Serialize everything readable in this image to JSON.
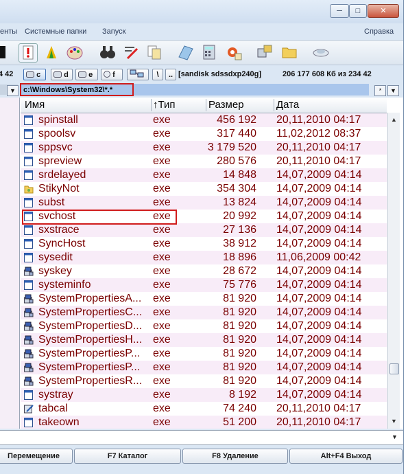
{
  "window": {
    "minimize_label": "─",
    "maximize_label": "□",
    "close_label": "✕"
  },
  "menu": [
    {
      "label": "енты"
    },
    {
      "label": "Системные папки"
    },
    {
      "label": "Запуск"
    },
    {
      "label": "Справка"
    }
  ],
  "toolbar_icons": [
    "black-square-icon",
    "exclamation-icon",
    "up-arrow-icon",
    "palette-icon",
    "binoculars-icon",
    "edit-pen-icon",
    "copy-document-icon",
    "notepad-icon",
    "calculator-icon",
    "settings-gear-icon",
    "network-icon",
    "folder-icon",
    "satellite-icon"
  ],
  "drives": {
    "left_fragment": "4 42",
    "items": [
      "c",
      "d",
      "e",
      "f"
    ],
    "active": "c",
    "extra": [
      "\\",
      ".."
    ],
    "volume_label": "[sandisk sdssdxp240g]",
    "space_info": "206 177 608 Кб из 234 42"
  },
  "path": {
    "text": "c:\\Windows\\System32\\*.*",
    "star_btn": "*",
    "dropdown_btn": "▼",
    "left_btn": "▼"
  },
  "columns": {
    "name": "Имя",
    "type": "↑Тип",
    "size": "Размер",
    "date": "Дата"
  },
  "files": [
    {
      "name": "spinstall",
      "ext": "exe",
      "size": "456 192",
      "date": "20,11,2010 04:17",
      "icon": "window"
    },
    {
      "name": "spoolsv",
      "ext": "exe",
      "size": "317 440",
      "date": "11,02,2012 08:37",
      "icon": "window"
    },
    {
      "name": "sppsvc",
      "ext": "exe",
      "size": "3 179 520",
      "date": "20,11,2010 04:17",
      "icon": "window"
    },
    {
      "name": "spreview",
      "ext": "exe",
      "size": "280 576",
      "date": "20,11,2010 04:17",
      "icon": "window"
    },
    {
      "name": "srdelayed",
      "ext": "exe",
      "size": "14 848",
      "date": "14,07,2009 04:14",
      "icon": "window"
    },
    {
      "name": "StikyNot",
      "ext": "exe",
      "size": "354 304",
      "date": "14,07,2009 04:14",
      "icon": "folder"
    },
    {
      "name": "subst",
      "ext": "exe",
      "size": "13 824",
      "date": "14,07,2009 04:14",
      "icon": "window"
    },
    {
      "name": "svchost",
      "ext": "exe",
      "size": "20 992",
      "date": "14,07,2009 04:14",
      "icon": "window"
    },
    {
      "name": "sxstrace",
      "ext": "exe",
      "size": "27 136",
      "date": "14,07,2009 04:14",
      "icon": "window"
    },
    {
      "name": "SyncHost",
      "ext": "exe",
      "size": "38 912",
      "date": "14,07,2009 04:14",
      "icon": "window"
    },
    {
      "name": "sysedit",
      "ext": "exe",
      "size": "18 896",
      "date": "11,06,2009 00:42",
      "icon": "window"
    },
    {
      "name": "syskey",
      "ext": "exe",
      "size": "28 672",
      "date": "14,07,2009 04:14",
      "icon": "system"
    },
    {
      "name": "systeminfo",
      "ext": "exe",
      "size": "75 776",
      "date": "14,07,2009 04:14",
      "icon": "window"
    },
    {
      "name": "SystemPropertiesA...",
      "ext": "exe",
      "size": "81 920",
      "date": "14,07,2009 04:14",
      "icon": "system"
    },
    {
      "name": "SystemPropertiesC...",
      "ext": "exe",
      "size": "81 920",
      "date": "14,07,2009 04:14",
      "icon": "system"
    },
    {
      "name": "SystemPropertiesD...",
      "ext": "exe",
      "size": "81 920",
      "date": "14,07,2009 04:14",
      "icon": "system"
    },
    {
      "name": "SystemPropertiesH...",
      "ext": "exe",
      "size": "81 920",
      "date": "14,07,2009 04:14",
      "icon": "system"
    },
    {
      "name": "SystemPropertiesP...",
      "ext": "exe",
      "size": "81 920",
      "date": "14,07,2009 04:14",
      "icon": "system"
    },
    {
      "name": "SystemPropertiesP...",
      "ext": "exe",
      "size": "81 920",
      "date": "14,07,2009 04:14",
      "icon": "system"
    },
    {
      "name": "SystemPropertiesR...",
      "ext": "exe",
      "size": "81 920",
      "date": "14,07,2009 04:14",
      "icon": "system"
    },
    {
      "name": "systray",
      "ext": "exe",
      "size": "8 192",
      "date": "14,07,2009 04:14",
      "icon": "window"
    },
    {
      "name": "tabcal",
      "ext": "exe",
      "size": "74 240",
      "date": "20,11,2010 04:17",
      "icon": "pen"
    },
    {
      "name": "takeown",
      "ext": "exe",
      "size": "51 200",
      "date": "20,11,2010 04:17",
      "icon": "window"
    }
  ],
  "highlighted_file": "svchost",
  "fkeys": [
    "Перемещение",
    "F7 Каталог",
    "F8 Удаление",
    "Alt+F4 Выход"
  ],
  "colors": {
    "row_alt": "#f8ecf8",
    "file_text": "#7a0000",
    "highlight": "#d01c1c",
    "path_bg": "#a9c6ec"
  }
}
